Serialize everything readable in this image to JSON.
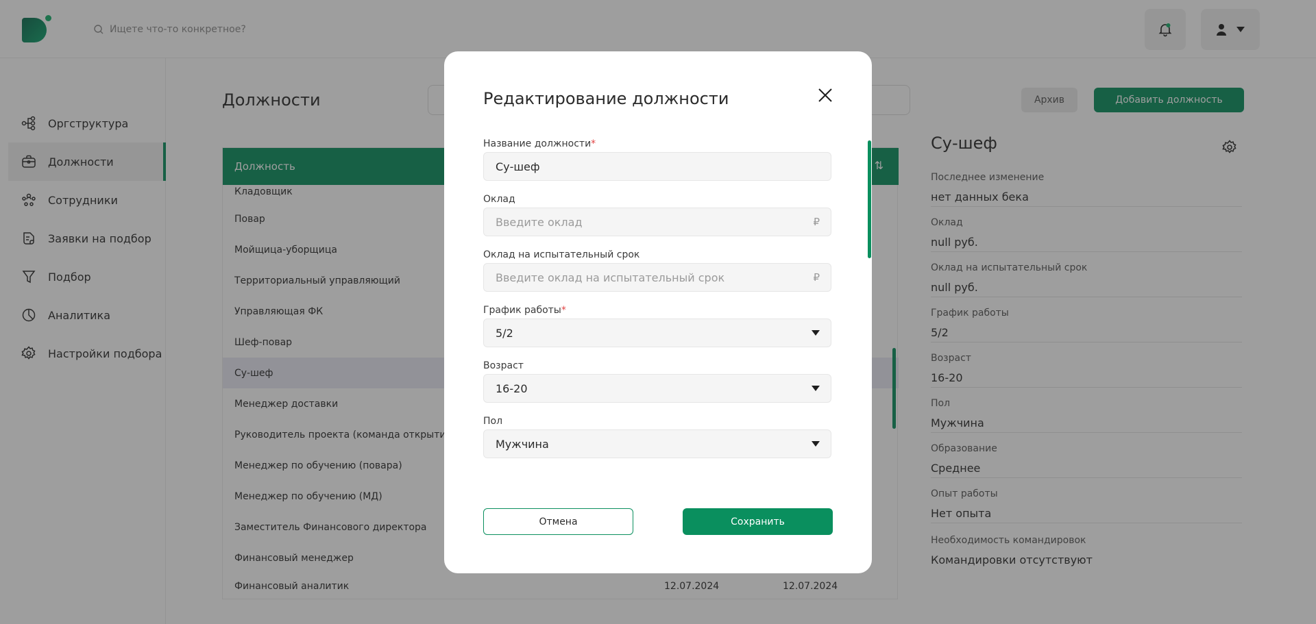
{
  "header": {
    "search_placeholder": "Ищете что-то конкретное?"
  },
  "sidebar": {
    "items": [
      {
        "label": "Оргструктура",
        "icon": "org-structure-icon"
      },
      {
        "label": "Должности",
        "icon": "briefcase-icon",
        "active": true
      },
      {
        "label": "Сотрудники",
        "icon": "people-icon"
      },
      {
        "label": "Заявки на подбор",
        "icon": "document-icon"
      },
      {
        "label": "Подбор",
        "icon": "funnel-icon"
      },
      {
        "label": "Аналитика",
        "icon": "pie-chart-icon"
      },
      {
        "label": "Настройки подбора",
        "icon": "gear-icon"
      }
    ]
  },
  "main": {
    "title": "Должности",
    "archive_label": "Архив",
    "add_label": "Добавить должность",
    "table": {
      "header": "Должность",
      "rows": [
        {
          "name": "Кладовщик"
        },
        {
          "name": "Повар"
        },
        {
          "name": "Мойщица-уборщица"
        },
        {
          "name": "Территориальный управляющий"
        },
        {
          "name": "Управляющая ФК"
        },
        {
          "name": "Шеф-повар"
        },
        {
          "name": "Су-шеф",
          "selected": true
        },
        {
          "name": "Менеджер доставки"
        },
        {
          "name": "Руководитель проекта (команда открытия YA"
        },
        {
          "name": "Менеджер по обучению (повара)"
        },
        {
          "name": "Менеджер по обучению (МД)"
        },
        {
          "name": "Заместитель Финансового директора"
        },
        {
          "name": "Финансовый менеджер"
        },
        {
          "name": "Финансовый аналитик",
          "date1": "12.07.2024",
          "date2": "12.07.2024"
        }
      ]
    }
  },
  "details": {
    "title": "Су-шеф",
    "fields": [
      {
        "label": "Последнее изменение",
        "value": "нет данных бека"
      },
      {
        "label": "Оклад",
        "value": "null руб."
      },
      {
        "label": "Оклад на испытательный срок",
        "value": "null руб."
      },
      {
        "label": "График работы",
        "value": "5/2"
      },
      {
        "label": "Возраст",
        "value": "16-20"
      },
      {
        "label": "Пол",
        "value": "Мужчина"
      },
      {
        "label": "Образование",
        "value": "Среднее"
      },
      {
        "label": "Опыт работы",
        "value": "Нет опыта"
      },
      {
        "label": "Необходимость командировок",
        "value": "Командировки отсутствуют"
      }
    ]
  },
  "modal": {
    "title": "Редактирование должности",
    "fields": {
      "name": {
        "label": "Название должности",
        "required_mark": "*",
        "value": "Су-шеф"
      },
      "salary": {
        "label": "Оклад",
        "placeholder": "Введите оклад",
        "suffix": "₽"
      },
      "trial_salary": {
        "label": "Оклад на испытательный срок",
        "placeholder": "Введите оклад на испытательный срок",
        "suffix": "₽"
      },
      "schedule": {
        "label": "График работы",
        "required_mark": "*",
        "value": "5/2"
      },
      "age": {
        "label": "Возраст",
        "value": "16-20"
      },
      "gender": {
        "label": "Пол",
        "value": "Мужчина"
      }
    },
    "cancel_label": "Отмена",
    "save_label": "Сохранить"
  },
  "colors": {
    "accent": "#0a8f5e",
    "required": "#e24444",
    "overlay": "rgba(40,40,40,0.45)"
  }
}
